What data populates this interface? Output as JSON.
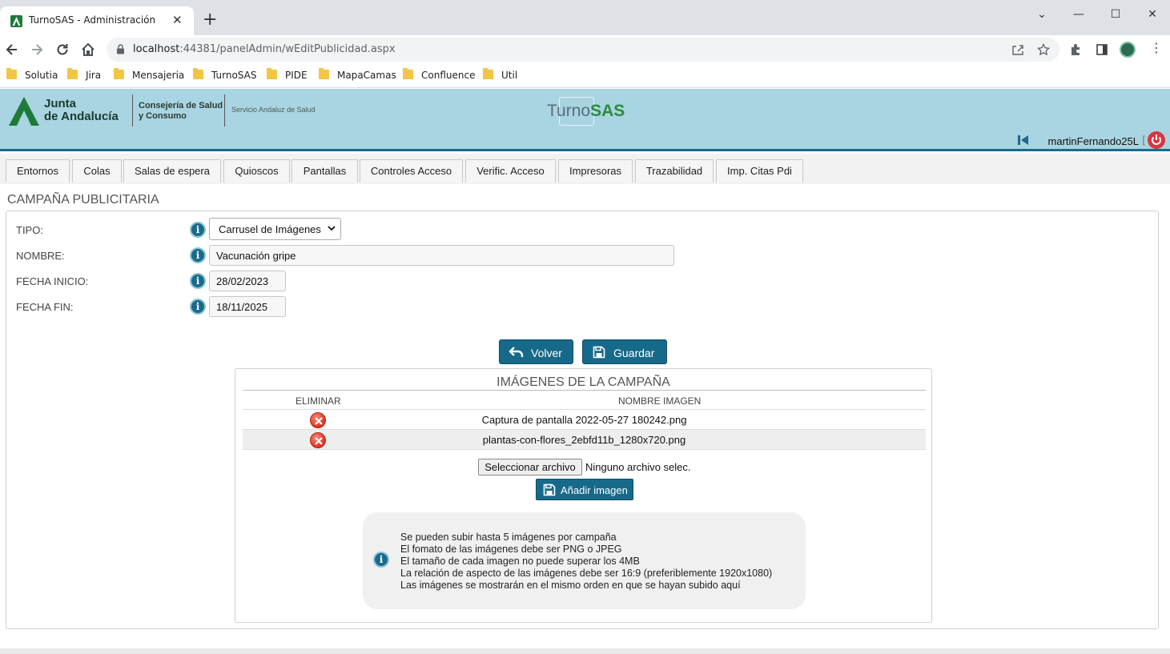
{
  "browser": {
    "tab_title": "TurnoSAS - Administración",
    "url_host": "localhost",
    "url_path": ":44381/panelAdmin/wEditPublicidad.aspx",
    "bookmarks": [
      "Solutia",
      "Jira",
      "Mensajeria",
      "TurnoSAS",
      "PIDE",
      "MapaCamas",
      "Confluence",
      "Util"
    ]
  },
  "header": {
    "logo_line1": "Junta",
    "logo_line2": "de Andalucía",
    "consejeria_line1": "Consejería de Salud",
    "consejeria_line2": "y Consumo",
    "servicio": "Servicio Andaluz de Salud",
    "app_name_prefix": "Turno",
    "app_name_suffix": "SAS",
    "username": "martinFernando25L",
    "accent_color": "#1a6b8a",
    "header_bg": "#a9d4e2"
  },
  "menu": {
    "tabs": [
      "Entornos",
      "Colas",
      "Salas de espera",
      "Quioscos",
      "Pantallas",
      "Controles Acceso",
      "Verific. Acceso",
      "Impresoras",
      "Trazabilidad",
      "Imp. Citas Pdi"
    ]
  },
  "page": {
    "title": "CAMPAÑA PUBLICITARIA"
  },
  "form": {
    "tipo_label": "TIPO:",
    "tipo_value": "Carrusel de Imágenes",
    "nombre_label": "NOMBRE:",
    "nombre_value": "Vacunación gripe",
    "fecha_inicio_label": "FECHA INICIO:",
    "fecha_inicio_value": "28/02/2023",
    "fecha_fin_label": "FECHA FIN:",
    "fecha_fin_value": "18/11/2025"
  },
  "actions": {
    "volver": "Volver",
    "guardar": "Guardar"
  },
  "images": {
    "title": "IMÁGENES DE LA CAMPAÑA",
    "col_eliminar": "ELIMINAR",
    "col_nombre": "NOMBRE IMAGEN",
    "rows": [
      {
        "name": "Captura de pantalla 2022-05-27 180242.png"
      },
      {
        "name": "plantas-con-flores_2ebfd11b_1280x720.png"
      }
    ],
    "file_button": "Seleccionar archivo",
    "file_none": "Ninguno archivo selec.",
    "add_button": "Añadir imagen"
  },
  "note": {
    "lines": [
      "Se pueden subir hasta 5 imágenes por campaña",
      "El fomato de las imágenes debe ser PNG o JPEG",
      "El tamaño de cada imagen no puede superar los 4MB",
      "La relación de aspecto de las imágenes debe ser 16:9 (preferiblemente 1920x1080)",
      "Las imágenes se mostrarán en el mismo orden en que se hayan subido aquí"
    ]
  }
}
